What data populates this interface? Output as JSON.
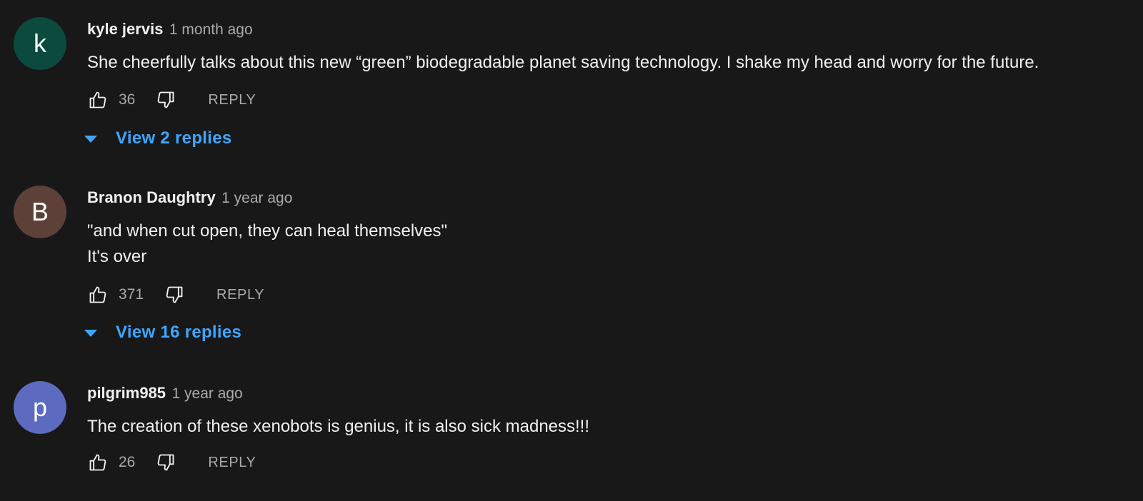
{
  "comments": [
    {
      "avatar_letter": "k",
      "avatar_color": "#0c4a3e",
      "author": "kyle jervis",
      "time": "1 month ago",
      "lines": [
        "She cheerfully talks about this new “green” biodegradable planet saving technology. I shake my head and worry for the future."
      ],
      "likes": "36",
      "reply_label": "REPLY",
      "view_replies": "View 2 replies"
    },
    {
      "avatar_letter": "B",
      "avatar_color": "#5d4037",
      "author": "Branon Daughtry",
      "time": "1 year ago",
      "lines": [
        "\"and when cut open, they can heal themselves\"",
        "It's over"
      ],
      "likes": "371",
      "reply_label": "REPLY",
      "view_replies": "View 16 replies"
    },
    {
      "avatar_letter": "p",
      "avatar_color": "#5c6bc0",
      "author": "pilgrim985",
      "time": "1 year ago",
      "lines": [
        "The creation of these xenobots is genius, it is also sick madness!!!"
      ],
      "likes": "26",
      "reply_label": "REPLY"
    }
  ],
  "colors": {
    "background": "#181818",
    "link_blue": "#3ea6ff",
    "secondary_text": "#aaaaaa"
  },
  "icons": [
    "thumb-up-icon",
    "thumb-down-icon",
    "caret-down-icon"
  ]
}
